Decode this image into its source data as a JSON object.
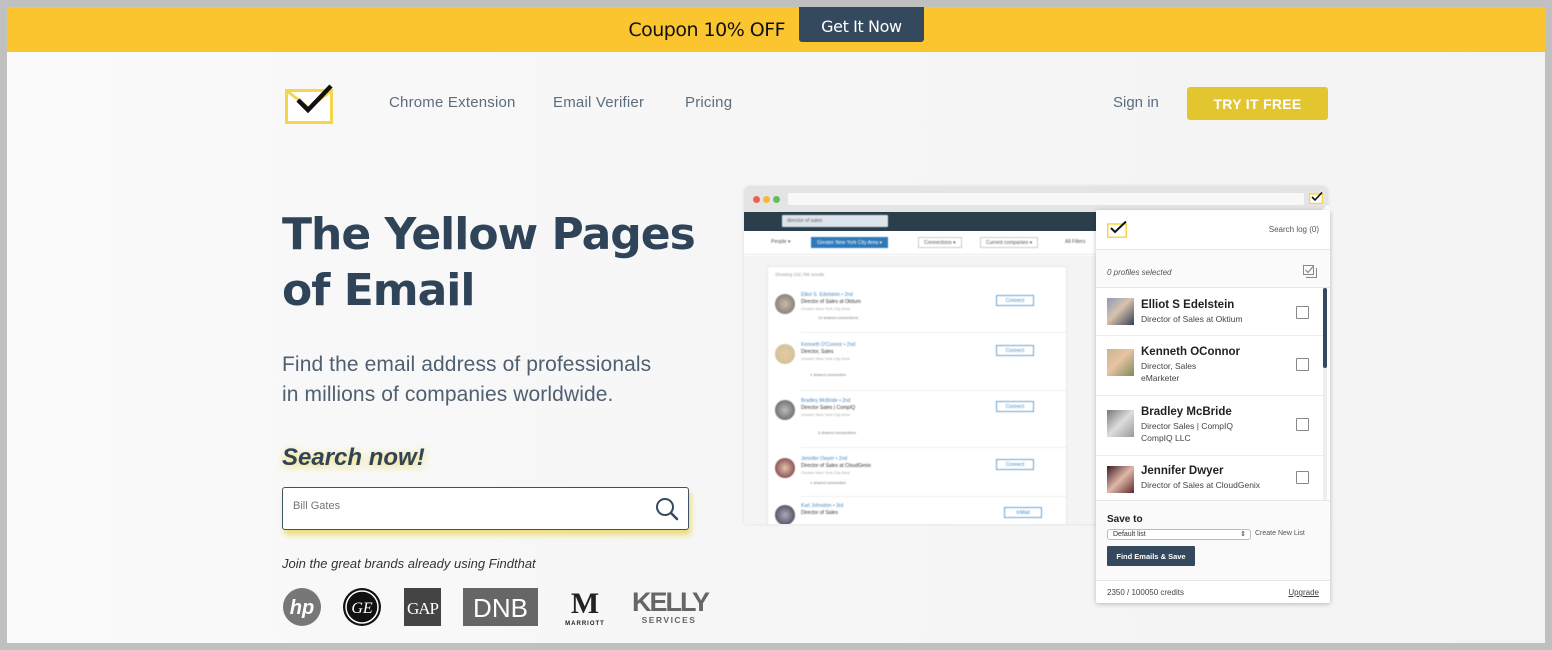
{
  "coupon": {
    "text": "Coupon 10% OFF",
    "button_label": "Get It Now"
  },
  "nav": {
    "logo_icon": "envelope-check-icon",
    "links": [
      "Chrome Extension",
      "Email Verifier",
      "Pricing"
    ],
    "sign_in": "Sign in",
    "cta": "TRY IT FREE"
  },
  "hero": {
    "title_line1": "The Yellow Pages",
    "title_line2": "of Email",
    "subtitle_line1": "Find the email address of professionals",
    "subtitle_line2": "in millions of companies worldwide.",
    "search_heading": "Search now!",
    "search_placeholder": "Bill Gates",
    "search_icon": "search-icon",
    "brands_caption": "Join the great brands already using Findthat",
    "brands": [
      "hp",
      "GE",
      "GAP",
      "DNB",
      "MARRIOTT",
      "KELLY SERVICES"
    ]
  },
  "mockup": {
    "search_query": "director of sales",
    "filters": [
      "People ▾",
      "Greater New York City Area ▾",
      "Connections ▾",
      "Current companies ▾",
      "All Filters"
    ],
    "results_count": "Showing 102,786 results",
    "results": [
      {
        "name": "Elliot S. Edelstein • 2nd",
        "title": "Director of Sales at Oktium",
        "location": "Greater New York City Area",
        "meta": "14 shared connections",
        "action": "Connect"
      },
      {
        "name": "Kenneth O'Connor • 2nd",
        "title": "Director, Sales",
        "location": "Greater New York City Area",
        "meta": "1 shared connection",
        "action": "Connect"
      },
      {
        "name": "Bradley McBride • 2nd",
        "title": "Director Sales | CompIQ",
        "location": "Greater New York City Area",
        "meta": "3 shared connections",
        "action": "Connect"
      },
      {
        "name": "Jennifer Dwyer • 2nd",
        "title": "Director of Sales at CloudGenix",
        "location": "Greater New York City Area",
        "meta": "1 shared connection",
        "action": "Connect"
      },
      {
        "name": "Karl Johnston • 3rd",
        "title": "Director of Sales",
        "location": "",
        "meta": "",
        "action": "InMail"
      }
    ]
  },
  "extension": {
    "search_log": "Search log (0)",
    "profiles_selected": "0 profiles selected",
    "profiles": [
      {
        "name": "Elliot S Edelstein",
        "line1": "Director of Sales at Oktium",
        "line2": "",
        "checked": false
      },
      {
        "name": "Kenneth OConnor",
        "line1": "Director, Sales",
        "line2": "eMarketer",
        "checked": false
      },
      {
        "name": "Bradley McBride",
        "line1": "Director Sales | CompIQ",
        "line2": "CompIQ LLC",
        "checked": false
      },
      {
        "name": "Jennifer Dwyer",
        "line1": "Director of Sales at CloudGenix",
        "line2": "",
        "checked": false
      }
    ],
    "save_to_label": "Save to",
    "list_selected": "Default list",
    "create_list": "Create New List",
    "find_button": "Find Emails & Save",
    "credits": "2350 / 100050 credits",
    "upgrade": "Upgrade"
  },
  "colors": {
    "coupon_bg": "#fbc530",
    "navy": "#34495e",
    "cta_yellow": "#e2c52f",
    "title_navy": "#2f4459"
  }
}
